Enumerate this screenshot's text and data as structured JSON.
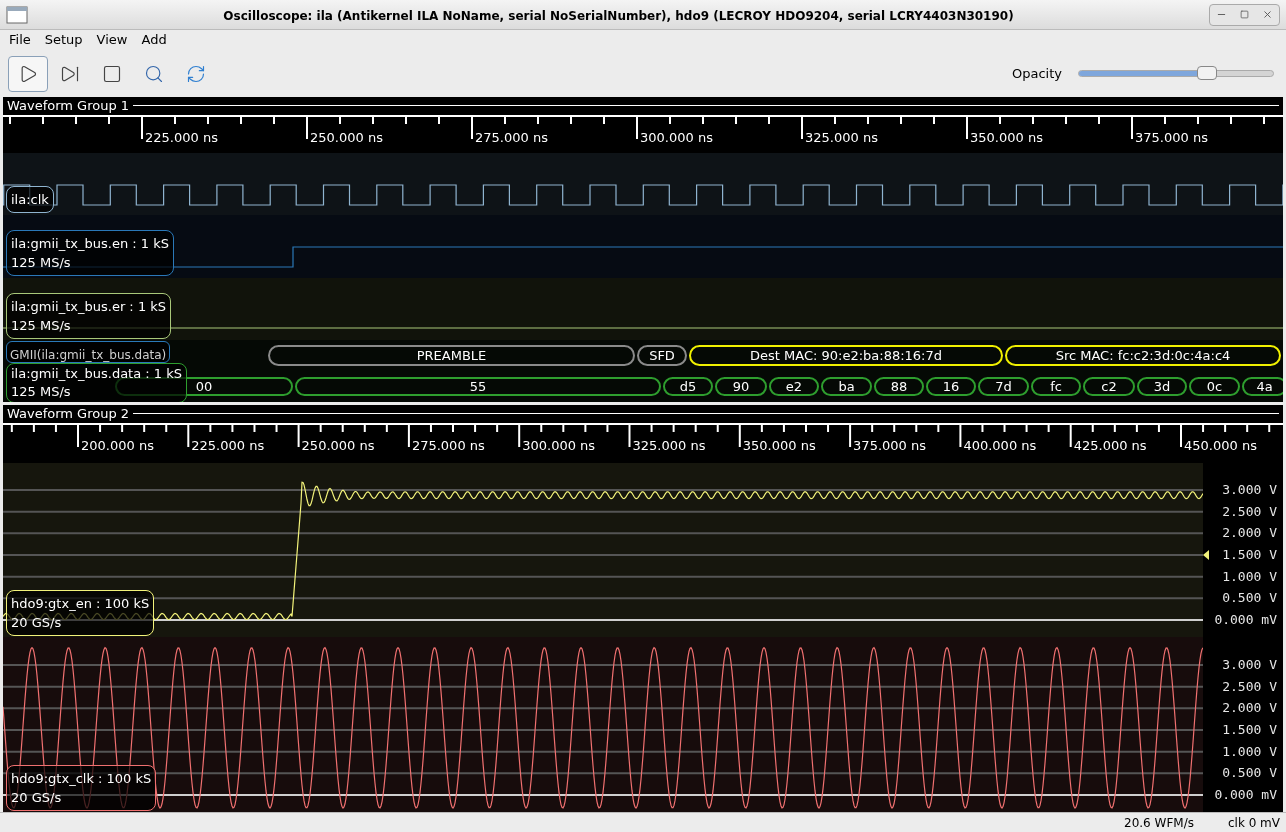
{
  "window": {
    "title": "Oscilloscope: ila (Antikernel ILA NoName, serial NoSerialNumber), hdo9 (LECROY HDO9204, serial LCRY4403N30190)"
  },
  "menu": [
    "File",
    "Setup",
    "View",
    "Add"
  ],
  "toolbar": [
    {
      "kind": "run",
      "selected": true
    },
    {
      "kind": "single",
      "selected": false
    },
    {
      "kind": "stop",
      "selected": false
    },
    {
      "kind": "zoom",
      "selected": false
    },
    {
      "kind": "refresh",
      "selected": false
    }
  ],
  "opacity": {
    "label": "Opacity",
    "level": 0.66
  },
  "groups": [
    {
      "title": "Waveform Group 1",
      "ruler": [
        "225.000 ns",
        "250.000 ns",
        "275.000 ns",
        "300.000 ns",
        "325.000 ns",
        "350.000 ns",
        "375.000 ns"
      ],
      "rows": [
        {
          "kind": "clock",
          "name": "ila:clk",
          "color": "#8fb4d0"
        },
        {
          "kind": "logic",
          "name": "ila:gmii_tx_bus.en : 1 kS",
          "rate": "125 MS/s",
          "color": "#2a78b8",
          "high_from_edge": true
        },
        {
          "kind": "logic",
          "name": "ila:gmii_tx_bus.er : 1 kS",
          "rate": "125 MS/s",
          "color": "#a9c87a",
          "high_from_edge": false
        },
        {
          "kind": "bus",
          "name": "ila:gmii_tx_bus.data : 1 kS",
          "rate": "125 MS/s",
          "color": "#2e9e2e",
          "decoder": {
            "name": "GMII(ila:gmii_tx_bus.data)",
            "color": "#2a78b8"
          },
          "packets": [
            {
              "text": "PREAMBLE",
              "color": "#8a8a8a"
            },
            {
              "text": "SFD",
              "color": "#8a8a8a"
            },
            {
              "text": "Dest MAC: 90:e2:ba:88:16:7d",
              "color": "#f0f000"
            },
            {
              "text": "Src MAC: fc:c2:3d:0c:4a:c4",
              "color": "#f0f000"
            }
          ],
          "bytes": [
            "00",
            "55",
            "d5",
            "90",
            "e2",
            "ba",
            "88",
            "16",
            "7d",
            "fc",
            "c2",
            "3d",
            "0c",
            "4a"
          ]
        }
      ]
    },
    {
      "title": "Waveform Group 2",
      "ruler": [
        "200.000 ns",
        "225.000 ns",
        "250.000 ns",
        "275.000 ns",
        "300.000 ns",
        "325.000 ns",
        "350.000 ns",
        "375.000 ns",
        "400.000 ns",
        "425.000 ns",
        "450.000 ns"
      ],
      "rows": [
        {
          "kind": "analog",
          "name": "hdo9:gtx_en : 100 kS",
          "rate": "20 GS/s",
          "color": "#f2f27a",
          "axis": [
            {
              "label": "3.000 V",
              "trigger": false
            },
            {
              "label": "2.500 V",
              "trigger": false
            },
            {
              "label": "2.000 V",
              "trigger": false
            },
            {
              "label": "1.500 V",
              "trigger": true
            },
            {
              "label": "1.000 V",
              "trigger": false
            },
            {
              "label": "0.500 V",
              "trigger": false
            },
            {
              "label": "0.000 mV",
              "trigger": false
            }
          ]
        },
        {
          "kind": "analog",
          "name": "hdo9:gtx_clk : 100 kS",
          "rate": "20 GS/s",
          "color": "#f07070",
          "axis": [
            {
              "label": "3.000 V",
              "trigger": false
            },
            {
              "label": "2.500 V",
              "trigger": false
            },
            {
              "label": "2.000 V",
              "trigger": false
            },
            {
              "label": "1.500 V",
              "trigger": false
            },
            {
              "label": "1.000 V",
              "trigger": false
            },
            {
              "label": "0.500 V",
              "trigger": false
            },
            {
              "label": "0.000 mV",
              "trigger": false
            }
          ]
        }
      ]
    }
  ],
  "status_bar": [
    "20.6 WFM/s",
    "clk 0 mV"
  ]
}
